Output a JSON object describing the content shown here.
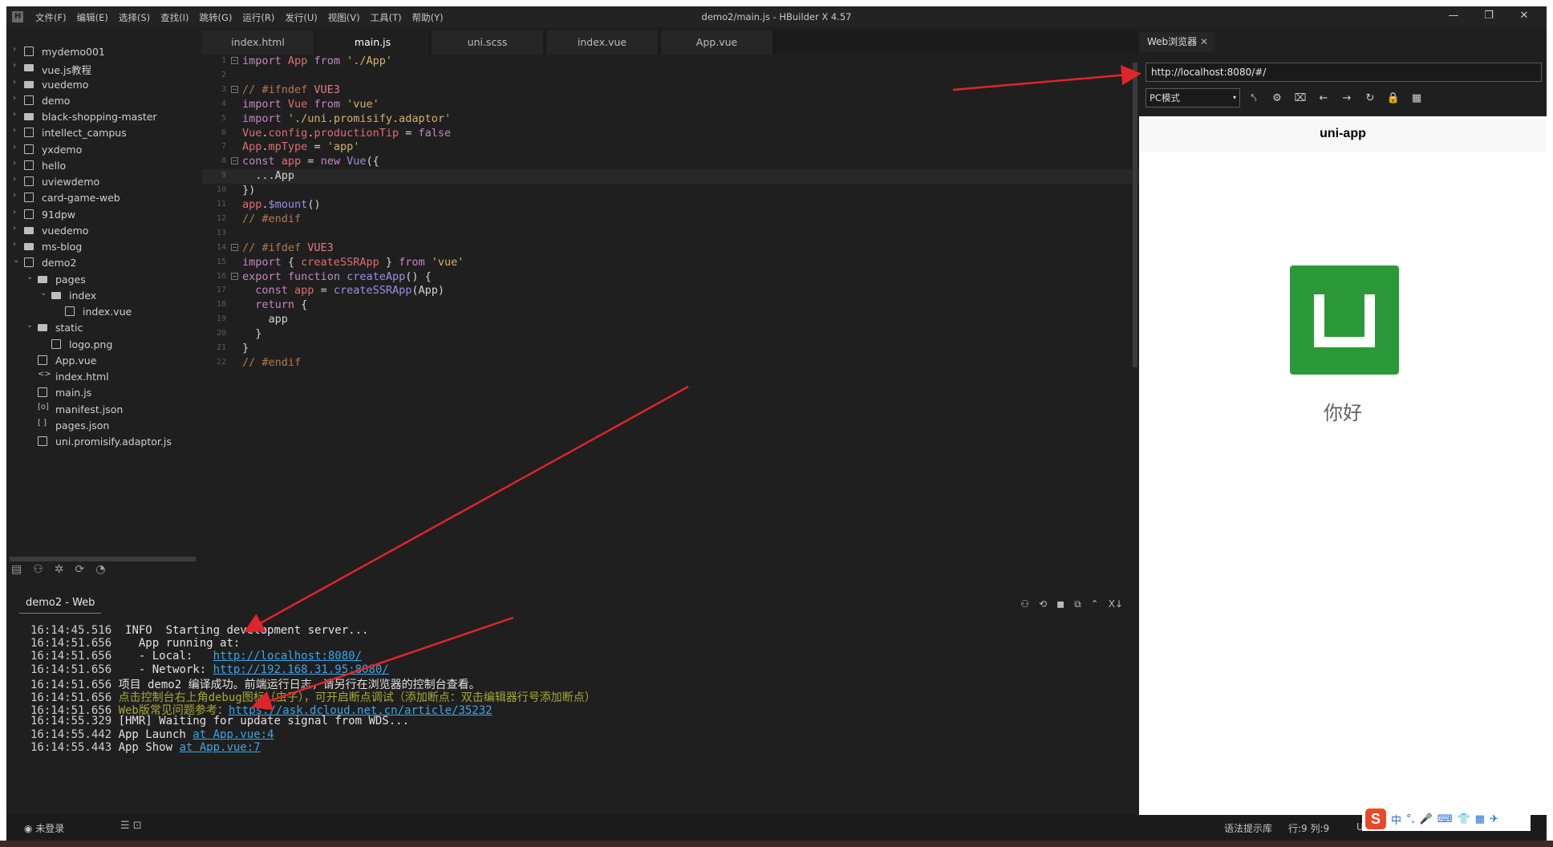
{
  "app": {
    "logo": "H",
    "title": "demo2/main.js - HBuilder X 4.57",
    "menu": [
      "文件(F)",
      "编辑(E)",
      "选择(S)",
      "查找(I)",
      "跳转(G)",
      "运行(R)",
      "发行(U)",
      "视图(V)",
      "工具(T)",
      "帮助(Y)"
    ],
    "controls": {
      "minimize": "—",
      "restore": "❐",
      "close": "✕"
    }
  },
  "tree": [
    {
      "label": "mydemo001",
      "icon": "uni-project-icon",
      "depth": 0,
      "chev": "›"
    },
    {
      "label": "vue.js教程",
      "icon": "folder-icon",
      "depth": 0,
      "chev": "›"
    },
    {
      "label": "vuedemo",
      "icon": "folder-icon",
      "depth": 0,
      "chev": "›"
    },
    {
      "label": "demo",
      "icon": "uni-project-icon",
      "depth": 0,
      "chev": "›"
    },
    {
      "label": "black-shopping-master",
      "icon": "folder-icon",
      "depth": 0,
      "chev": "›"
    },
    {
      "label": "intellect_campus",
      "icon": "uni-project-icon",
      "depth": 0,
      "chev": "›"
    },
    {
      "label": "yxdemo",
      "icon": "uni-project-icon",
      "depth": 0,
      "chev": "›"
    },
    {
      "label": "hello",
      "icon": "uni-project-icon",
      "depth": 0,
      "chev": "›"
    },
    {
      "label": "uviewdemo",
      "icon": "uni-project-icon",
      "depth": 0,
      "chev": "›"
    },
    {
      "label": "card-game-web",
      "icon": "uni-project-icon",
      "depth": 0,
      "chev": "›"
    },
    {
      "label": "91dpw",
      "icon": "uni-project-icon",
      "depth": 0,
      "chev": "›"
    },
    {
      "label": "vuedemo",
      "icon": "folder-icon",
      "depth": 0,
      "chev": "›"
    },
    {
      "label": "ms-blog",
      "icon": "folder-icon",
      "depth": 0,
      "chev": "›"
    },
    {
      "label": "demo2",
      "icon": "uni-project-icon",
      "depth": 0,
      "chev": "⌄"
    },
    {
      "label": "pages",
      "icon": "folder-icon",
      "depth": 1,
      "chev": "⌄"
    },
    {
      "label": "index",
      "icon": "folder-icon",
      "depth": 2,
      "chev": "⌄"
    },
    {
      "label": "index.vue",
      "icon": "vue-file-icon",
      "depth": 3,
      "chev": ""
    },
    {
      "label": "static",
      "icon": "folder-icon",
      "depth": 1,
      "chev": "⌄"
    },
    {
      "label": "logo.png",
      "icon": "image-file-icon",
      "depth": 2,
      "chev": ""
    },
    {
      "label": "App.vue",
      "icon": "vue-file-icon",
      "depth": 1,
      "chev": ""
    },
    {
      "label": "index.html",
      "icon": "html-file-icon",
      "depth": 1,
      "chev": ""
    },
    {
      "label": "main.js",
      "icon": "js-file-icon",
      "depth": 1,
      "chev": ""
    },
    {
      "label": "manifest.json",
      "icon": "json-file-icon",
      "depth": 1,
      "chev": ""
    },
    {
      "label": "pages.json",
      "icon": "json-file-icon",
      "depth": 1,
      "chev": ""
    },
    {
      "label": "uni.promisify.adaptor.js",
      "icon": "js-file-icon",
      "depth": 1,
      "chev": ""
    }
  ],
  "tree_glyphs": {
    "code_bracket": "<>",
    "json_bracket": "[o]",
    "pages_bracket": "[ ]"
  },
  "sidefoot": [
    "▤",
    "⚇",
    "✲",
    "⟳",
    "◔"
  ],
  "tabs": [
    "index.html",
    "main.js",
    "uni.scss",
    "index.vue",
    "App.vue"
  ],
  "active_tab": "main.js",
  "code": [
    [
      [
        "kw",
        "import"
      ],
      [
        "plain",
        " "
      ],
      [
        "ident",
        "App"
      ],
      [
        "plain",
        " "
      ],
      [
        "kw",
        "from"
      ],
      [
        "plain",
        " "
      ],
      [
        "str",
        "'./App'"
      ]
    ],
    [],
    [
      [
        "cm",
        "// #ifndef "
      ],
      [
        "kw2",
        "VUE3"
      ]
    ],
    [
      [
        "kw",
        "import"
      ],
      [
        "plain",
        " "
      ],
      [
        "ident",
        "Vue"
      ],
      [
        "plain",
        " "
      ],
      [
        "kw",
        "from"
      ],
      [
        "plain",
        " "
      ],
      [
        "str",
        "'vue'"
      ]
    ],
    [
      [
        "kw",
        "import"
      ],
      [
        "plain",
        " "
      ],
      [
        "str",
        "'./uni.promisify.adaptor'"
      ]
    ],
    [
      [
        "ident",
        "Vue"
      ],
      [
        "plain",
        "."
      ],
      [
        "ident",
        "config"
      ],
      [
        "plain",
        "."
      ],
      [
        "ident",
        "productionTip"
      ],
      [
        "plain",
        " = "
      ],
      [
        "kw",
        "false"
      ]
    ],
    [
      [
        "ident",
        "App"
      ],
      [
        "plain",
        "."
      ],
      [
        "ident",
        "mpType"
      ],
      [
        "plain",
        " = "
      ],
      [
        "str",
        "'app'"
      ]
    ],
    [
      [
        "kw",
        "const"
      ],
      [
        "plain",
        " "
      ],
      [
        "ident",
        "app"
      ],
      [
        "plain",
        " = "
      ],
      [
        "kw",
        "new"
      ],
      [
        "plain",
        " "
      ],
      [
        "fn",
        "Vue"
      ],
      [
        "plain",
        "({"
      ]
    ],
    [
      [
        "plain",
        "  ..."
      ],
      [
        "plain",
        "App"
      ]
    ],
    [
      [
        "plain",
        "})"
      ]
    ],
    [
      [
        "ident",
        "app"
      ],
      [
        "plain",
        "."
      ],
      [
        "fn",
        "$mount"
      ],
      [
        "plain",
        "()"
      ]
    ],
    [
      [
        "cm",
        "// #endif"
      ]
    ],
    [],
    [
      [
        "cm",
        "// #ifdef "
      ],
      [
        "kw2",
        "VUE3"
      ]
    ],
    [
      [
        "kw",
        "import"
      ],
      [
        "plain",
        " { "
      ],
      [
        "ident",
        "createSSRApp"
      ],
      [
        "plain",
        " } "
      ],
      [
        "kw",
        "from"
      ],
      [
        "plain",
        " "
      ],
      [
        "str",
        "'vue'"
      ]
    ],
    [
      [
        "kw",
        "export"
      ],
      [
        "plain",
        " "
      ],
      [
        "kw",
        "function"
      ],
      [
        "plain",
        " "
      ],
      [
        "fn",
        "createApp"
      ],
      [
        "plain",
        "() {"
      ]
    ],
    [
      [
        "plain",
        "  "
      ],
      [
        "kw",
        "const"
      ],
      [
        "plain",
        " "
      ],
      [
        "ident",
        "app"
      ],
      [
        "plain",
        " = "
      ],
      [
        "fn",
        "createSSRApp"
      ],
      [
        "plain",
        "(App)"
      ]
    ],
    [
      [
        "plain",
        "  "
      ],
      [
        "kw",
        "return"
      ],
      [
        "plain",
        " {"
      ]
    ],
    [
      [
        "plain",
        "    app"
      ]
    ],
    [
      [
        "plain",
        "  }"
      ]
    ],
    [
      [
        "plain",
        "}"
      ]
    ],
    [
      [
        "cm",
        "// #endif"
      ]
    ]
  ],
  "fold_lines": [
    1,
    3,
    8,
    14,
    16
  ],
  "browser": {
    "tab": "Web浏览器",
    "tab_close": "✕",
    "url": "http://localhost:8080/#/",
    "mode": "PC模式",
    "mode_arrow": "▾",
    "tools": [
      "⤣",
      "⚙",
      "⌧",
      "←",
      "→",
      "↻",
      "🔒",
      "▦"
    ],
    "nav_title": "uni-app",
    "hello": "你好"
  },
  "console": {
    "tab": "demo2 - Web",
    "icons": [
      "⚇",
      "⟲",
      "◼",
      "⧉",
      "⌃",
      "X↓"
    ],
    "logs": [
      [
        [
          "t",
          "16:14:45.516  "
        ],
        [
          "p",
          "INFO  Starting development server..."
        ]
      ],
      [
        [
          "t",
          "16:14:51.656  "
        ],
        [
          "p",
          "  App running at:"
        ]
      ],
      [
        [
          "t",
          "16:14:51.656  "
        ],
        [
          "p",
          "  - Local:   "
        ],
        [
          "lnk",
          "http://localhost:8080/"
        ]
      ],
      [
        [
          "t",
          "16:14:51.656  "
        ],
        [
          "p",
          "  - Network: "
        ],
        [
          "lnk",
          "http://192.168.31.95:8080/"
        ]
      ],
      [
        [
          "t",
          "16:14:51.656 "
        ],
        [
          "p",
          "项目 demo2 编译成功。前端运行日志，请另行在浏览器的控制台查看。"
        ]
      ],
      [
        [
          "t",
          "16:14:51.656 "
        ],
        [
          "y",
          "点击控制台右上角debug图标（虫子），可开启断点调试（添加断点：双击编辑器行号添加断点）"
        ]
      ],
      [
        [
          "t",
          "16:14:51.656 "
        ],
        [
          "y",
          "Web版常见问题参考："
        ],
        [
          "lnk",
          "https://ask.dcloud.net.cn/article/35232"
        ]
      ],
      [
        [
          "t",
          "16:14:55.329 "
        ],
        [
          "p",
          "[HMR] Waiting for update signal from WDS..."
        ]
      ],
      [
        [
          "t",
          "16:14:55.442 "
        ],
        [
          "p",
          "App Launch "
        ],
        [
          "lnk",
          "at App.vue:4"
        ]
      ],
      [
        [
          "t",
          "16:14:55.443 "
        ],
        [
          "p",
          "App Show "
        ],
        [
          "lnk",
          "at App.vue:7"
        ]
      ]
    ]
  },
  "status": {
    "login": "◉ 未登录",
    "icons": "☰  ⊡",
    "hint": "语法提示库",
    "pos": "行:9  列:9",
    "enc": "UT"
  },
  "ime": {
    "logo": "S",
    "items": [
      "中",
      "°,",
      "🎤",
      "⌨",
      "👕",
      "▦",
      "✈"
    ]
  },
  "colors": {
    "accent_red": "#e0242b",
    "logo_green": "#2b9939",
    "link": "#3ba6e8"
  }
}
